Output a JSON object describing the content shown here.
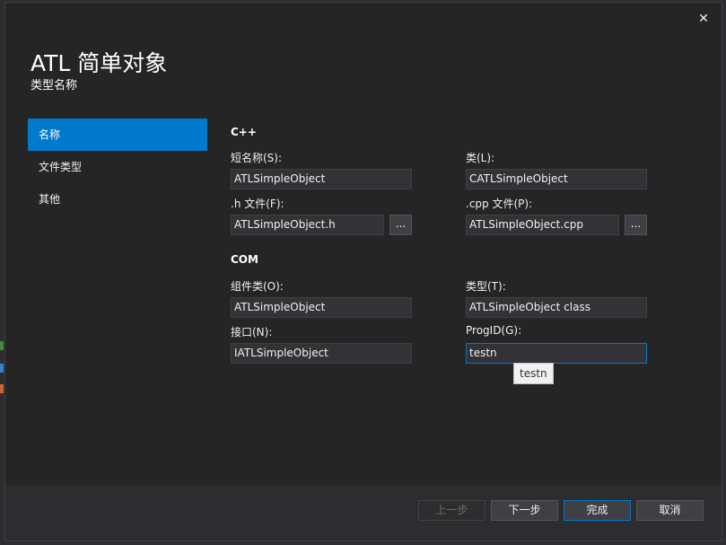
{
  "dialog": {
    "title": "ATL 简单对象",
    "subtitle": "类型名称",
    "close_glyph": "✕"
  },
  "nav": {
    "items": [
      {
        "label": "名称",
        "active": true
      },
      {
        "label": "文件类型",
        "active": false
      },
      {
        "label": "其他",
        "active": false
      }
    ]
  },
  "cpp": {
    "section": "C++",
    "short_name_label": "短名称(S):",
    "short_name_value": "ATLSimpleObject",
    "class_label": "类(L):",
    "class_value": "CATLSimpleObject",
    "h_file_label": ".h 文件(F):",
    "h_file_value": "ATLSimpleObject.h",
    "cpp_file_label": ".cpp 文件(P):",
    "cpp_file_value": "ATLSimpleObject.cpp",
    "browse_label": "..."
  },
  "com": {
    "section": "COM",
    "coclass_label": "组件类(O):",
    "coclass_value": "ATLSimpleObject",
    "type_label": "类型(T):",
    "type_value": "ATLSimpleObject class",
    "interface_label": "接口(N):",
    "interface_value": "IATLSimpleObject",
    "progid_label": "ProgID(G):",
    "progid_value": "testn",
    "tooltip": "testn"
  },
  "footer": {
    "prev_label": "上一步",
    "next_label": "下一步",
    "finish_label": "完成",
    "cancel_label": "取消"
  },
  "colors": {
    "accent": "#007acc",
    "background": "#252526"
  }
}
